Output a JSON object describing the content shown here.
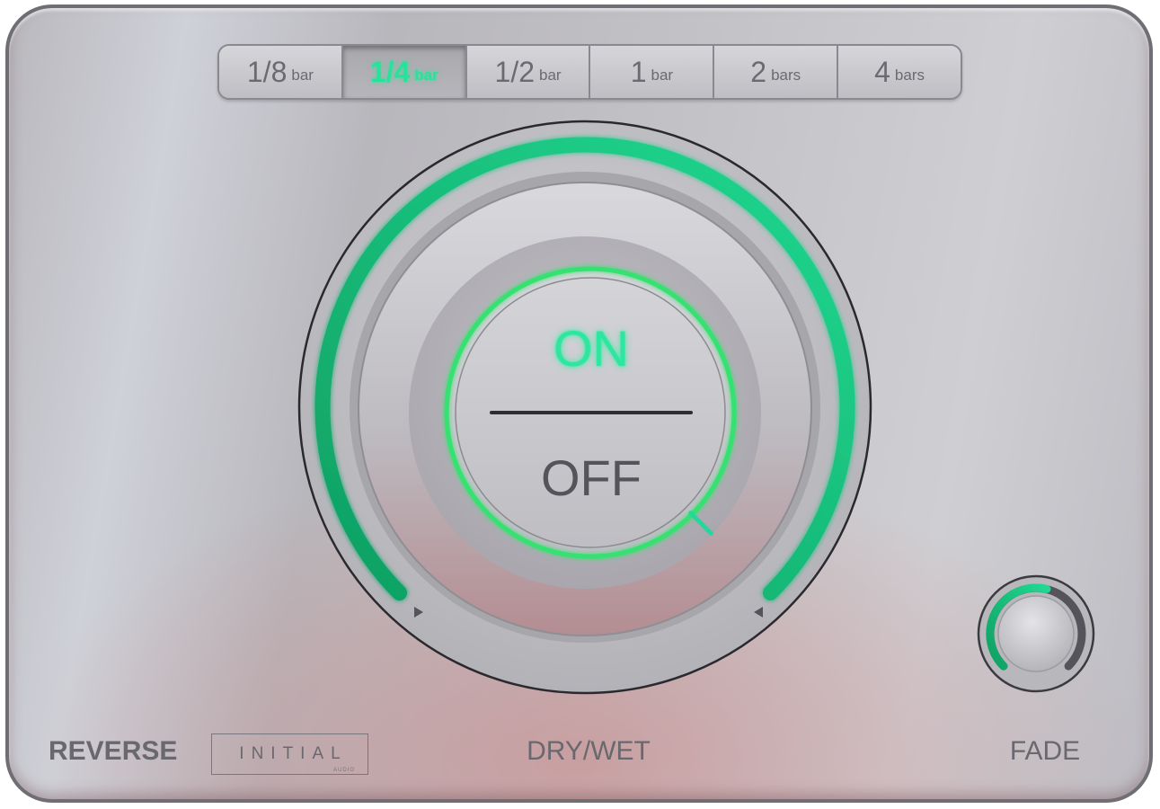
{
  "length_selector": {
    "options": [
      {
        "num": "1/8",
        "unit": "bar"
      },
      {
        "num": "1/4",
        "unit": "bar"
      },
      {
        "num": "1/2",
        "unit": "bar"
      },
      {
        "num": "1",
        "unit": "bar"
      },
      {
        "num": "2",
        "unit": "bars"
      },
      {
        "num": "4",
        "unit": "bars"
      }
    ],
    "selected": "1/4"
  },
  "main_button": {
    "on_label": "ON",
    "off_label": "OFF",
    "state": "on"
  },
  "dry_wet": {
    "label": "DRY/WET",
    "value_fraction": 1.0
  },
  "fade": {
    "label": "FADE",
    "value_fraction": 0.55
  },
  "reverse": {
    "label": "REVERSE"
  },
  "logo": {
    "word": "INITIAL",
    "sub": "AUDIO"
  },
  "colors": {
    "accent_green": "#25e39b",
    "panel": "#c4c3c8",
    "text": "#69686e"
  }
}
